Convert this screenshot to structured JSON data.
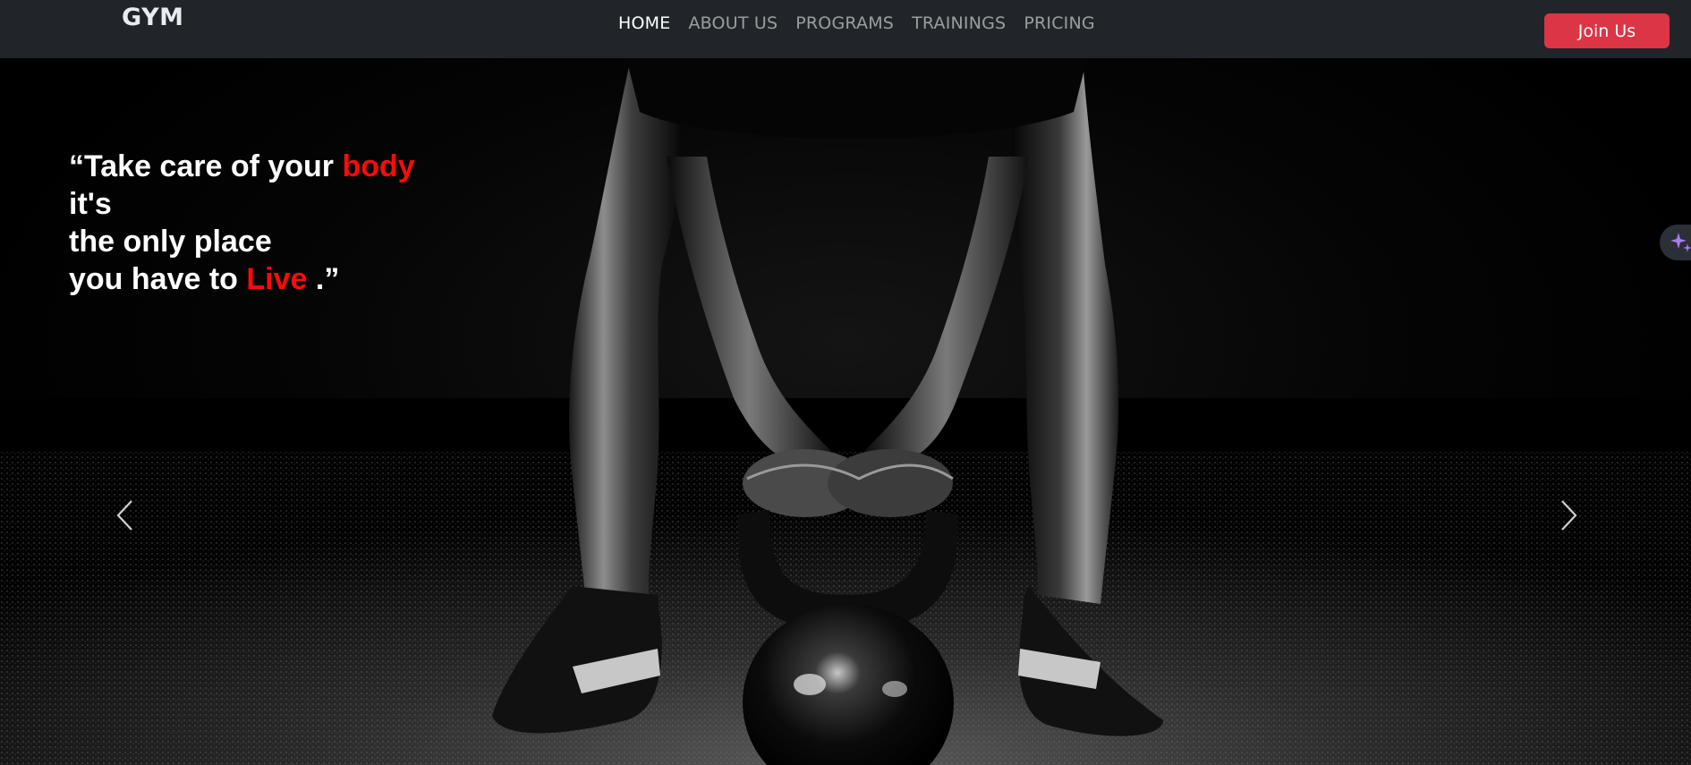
{
  "navbar": {
    "brand": "GYM",
    "links": [
      {
        "label": "HOME",
        "active": true
      },
      {
        "label": "ABOUT US",
        "active": false
      },
      {
        "label": "PROGRAMS",
        "active": false
      },
      {
        "label": "TRAININGS",
        "active": false
      },
      {
        "label": "PRICING",
        "active": false
      }
    ],
    "cta_label": "Join Us"
  },
  "hero": {
    "quote": {
      "line1_pre": "“Take care of your ",
      "line1_highlight": "body",
      "line2": "it's",
      "line3": "the only place",
      "line4_pre": "you have to ",
      "line4_highlight": "Live",
      "line4_post": " .”"
    },
    "prev_icon": "chevron-left-icon",
    "next_icon": "chevron-right-icon",
    "image_subject": "athlete-lifting-kettlebell"
  },
  "assistant_tab": {
    "icon": "sparkle-icon"
  },
  "colors": {
    "navbar_bg": "#212529",
    "accent_red": "#dc3545",
    "quote_highlight": "#ff0a0a",
    "nav_link": "#8c8f93",
    "nav_link_active": "#ffffff",
    "sparkle": "#a47cf3"
  }
}
